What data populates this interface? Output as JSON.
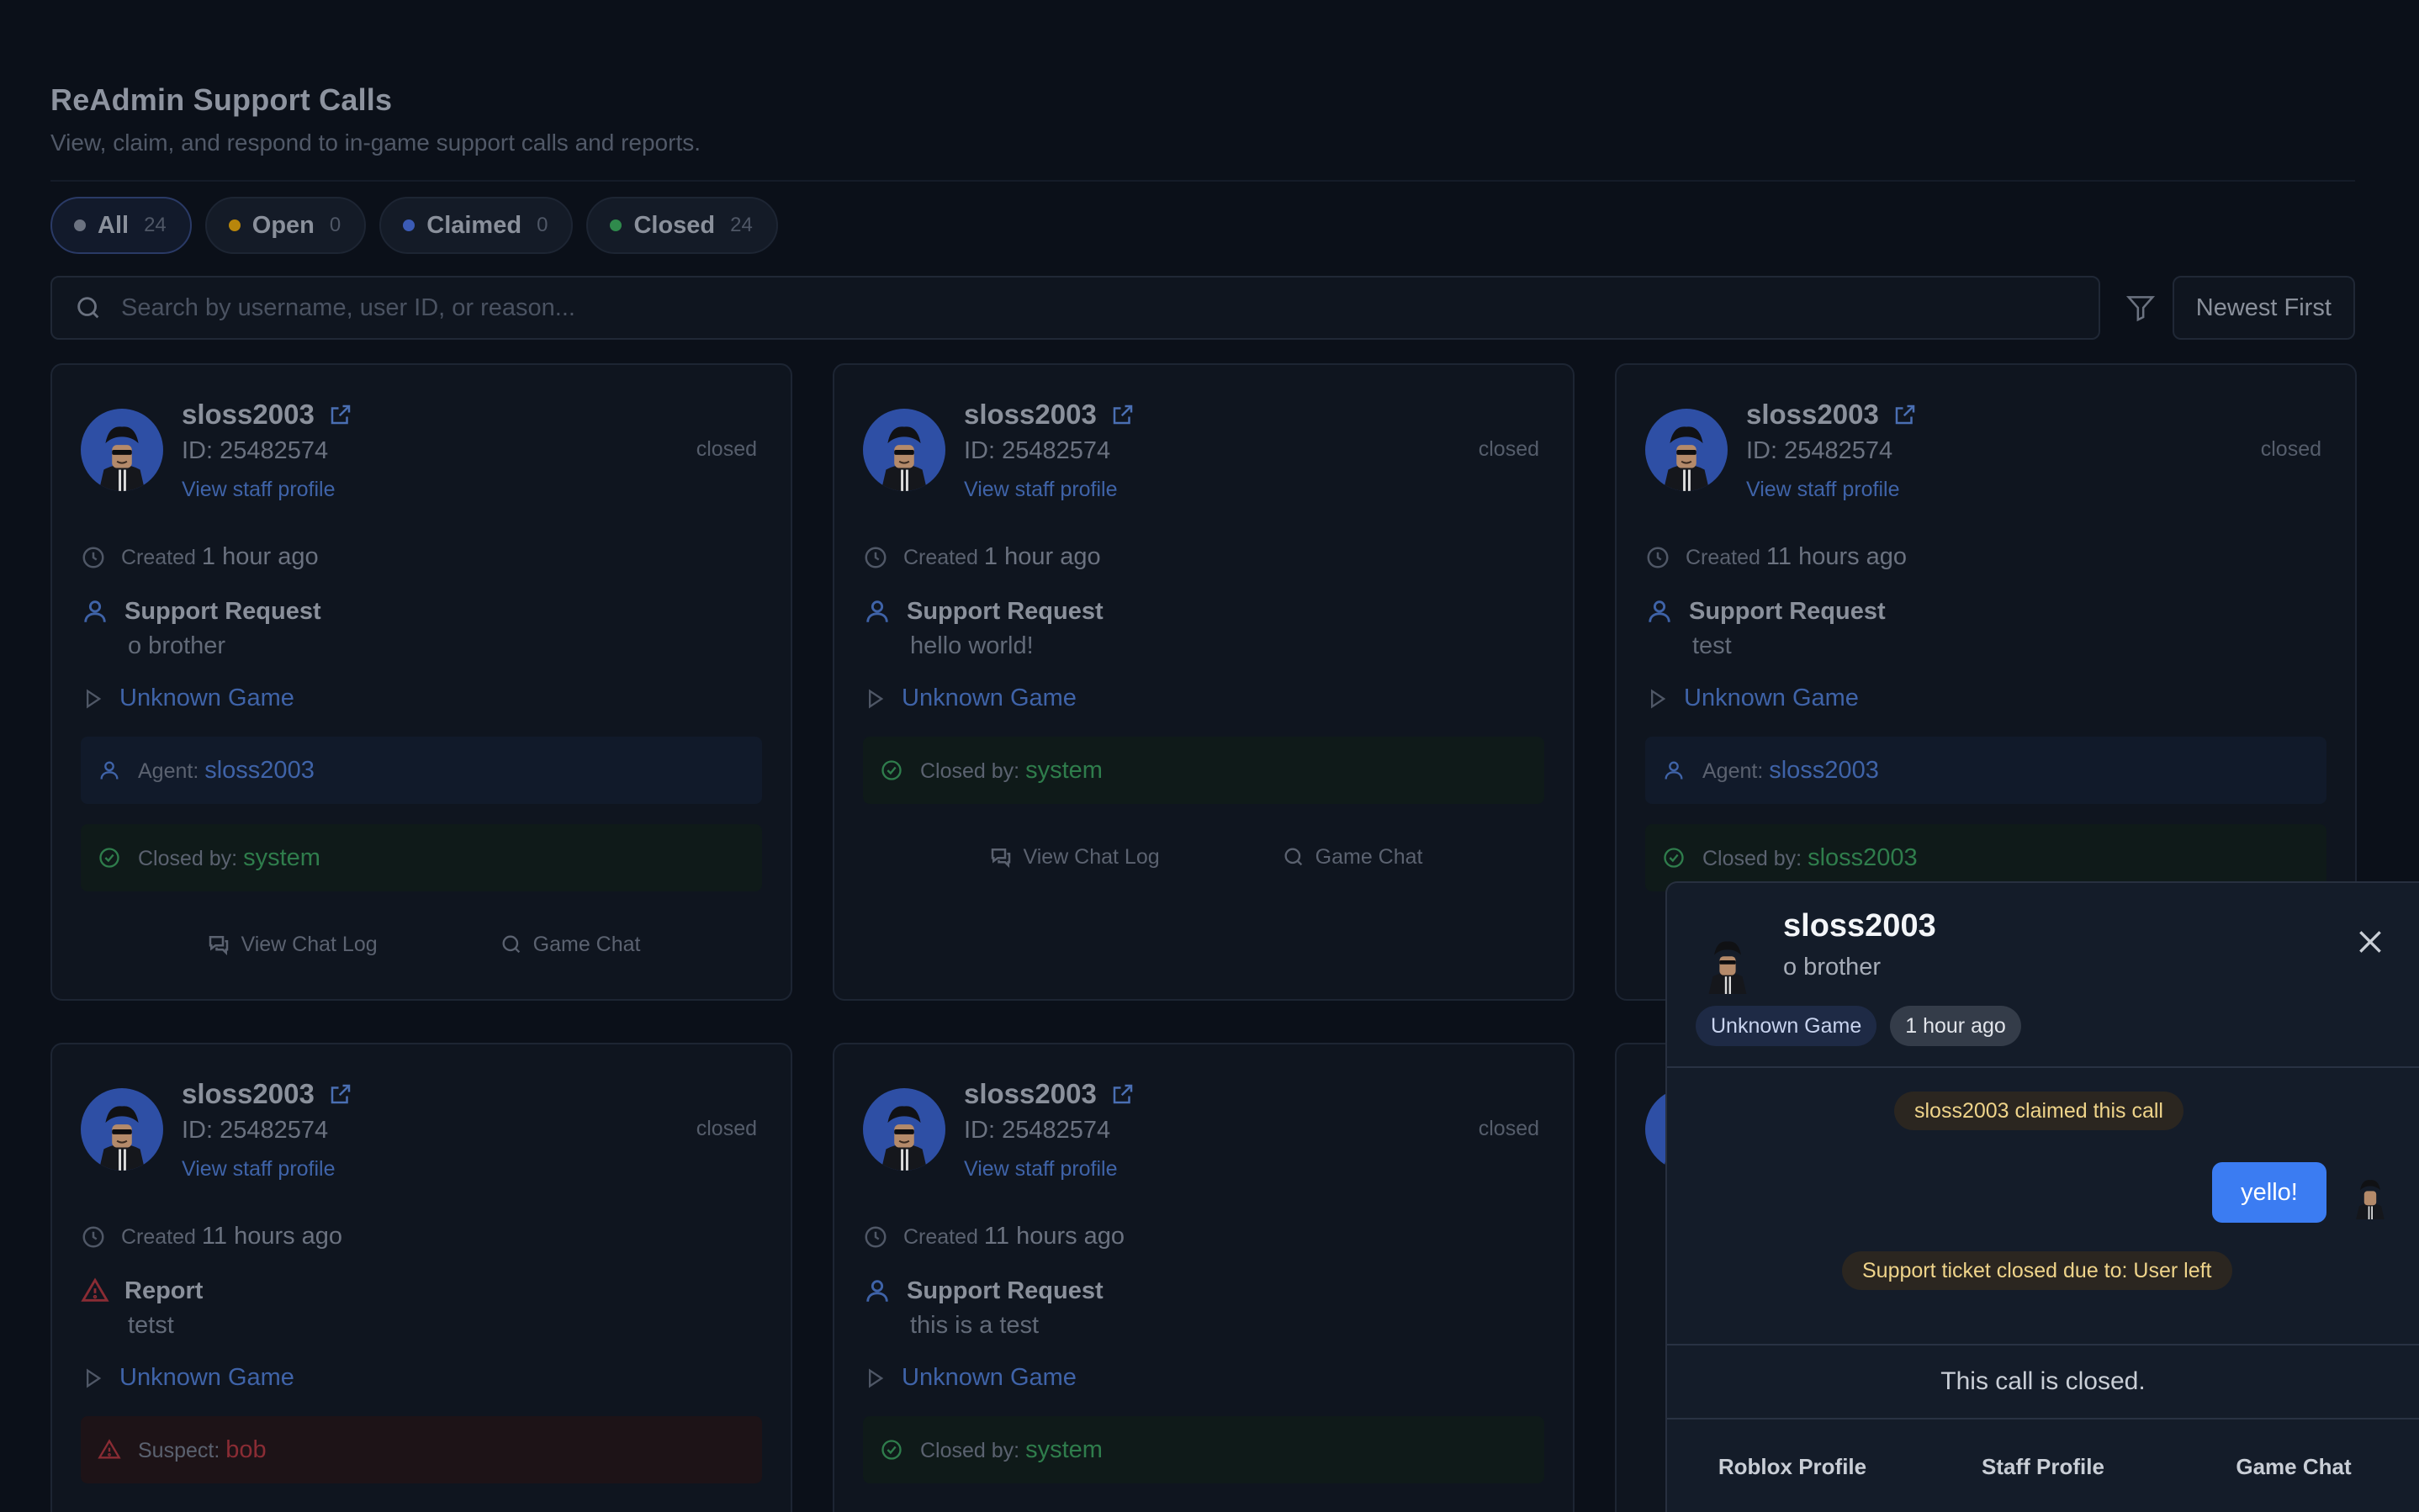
{
  "header": {
    "title": "ReAdmin Support Calls",
    "subtitle": "View, claim, and respond to in-game support calls and reports."
  },
  "tabs": [
    {
      "label": "All",
      "count": "24",
      "dot_color": "#6b7280"
    },
    {
      "label": "Open",
      "count": "0",
      "dot_color": "#b8860b"
    },
    {
      "label": "Claimed",
      "count": "0",
      "dot_color": "#3b5bb5"
    },
    {
      "label": "Closed",
      "count": "24",
      "dot_color": "#2f8a4c"
    }
  ],
  "search": {
    "placeholder": "Search by username, user ID, or reason...",
    "sort_label": "Newest First"
  },
  "common": {
    "view_staff": "View staff profile",
    "created_prefix": "Created",
    "agent_prefix": "Agent:",
    "closed_prefix": "Closed by:",
    "suspect_prefix": "Suspect:",
    "view_chat_log": "View Chat Log",
    "game_chat": "Game Chat"
  },
  "cards": [
    {
      "username": "sloss2003",
      "id": "ID: 25482574",
      "status": "closed",
      "created": "1 hour ago",
      "kind": "Support Request",
      "reason": "o brother",
      "game": "Unknown Game",
      "agent": "sloss2003",
      "closed_by": "system"
    },
    {
      "username": "sloss2003",
      "id": "ID: 25482574",
      "status": "closed",
      "created": "1 hour ago",
      "kind": "Support Request",
      "reason": "hello world!",
      "game": "Unknown Game",
      "closed_by": "system"
    },
    {
      "username": "sloss2003",
      "id": "ID: 25482574",
      "status": "closed",
      "created": "11 hours ago",
      "kind": "Support Request",
      "reason": "test",
      "game": "Unknown Game",
      "agent": "sloss2003",
      "closed_by": "sloss2003"
    },
    {
      "username": "sloss2003",
      "id": "ID: 25482574",
      "status": "closed",
      "created": "11 hours ago",
      "kind": "Report",
      "reason": "tetst",
      "game": "Unknown Game",
      "suspect": "bob"
    },
    {
      "username": "sloss2003",
      "id": "ID: 25482574",
      "status": "closed",
      "created": "11 hours ago",
      "kind": "Support Request",
      "reason": "this is a test",
      "game": "Unknown Game",
      "closed_by": "system"
    }
  ],
  "panel": {
    "username": "sloss2003",
    "reason": "o brother",
    "game_tag": "Unknown Game",
    "time_tag": "1 hour ago",
    "system_claimed": "sloss2003 claimed this call",
    "message": "yello!",
    "system_closed": "Support ticket closed due to: User left",
    "closed_notice": "This call is closed.",
    "footer": [
      "Roblox Profile",
      "Staff Profile",
      "Game Chat"
    ]
  }
}
